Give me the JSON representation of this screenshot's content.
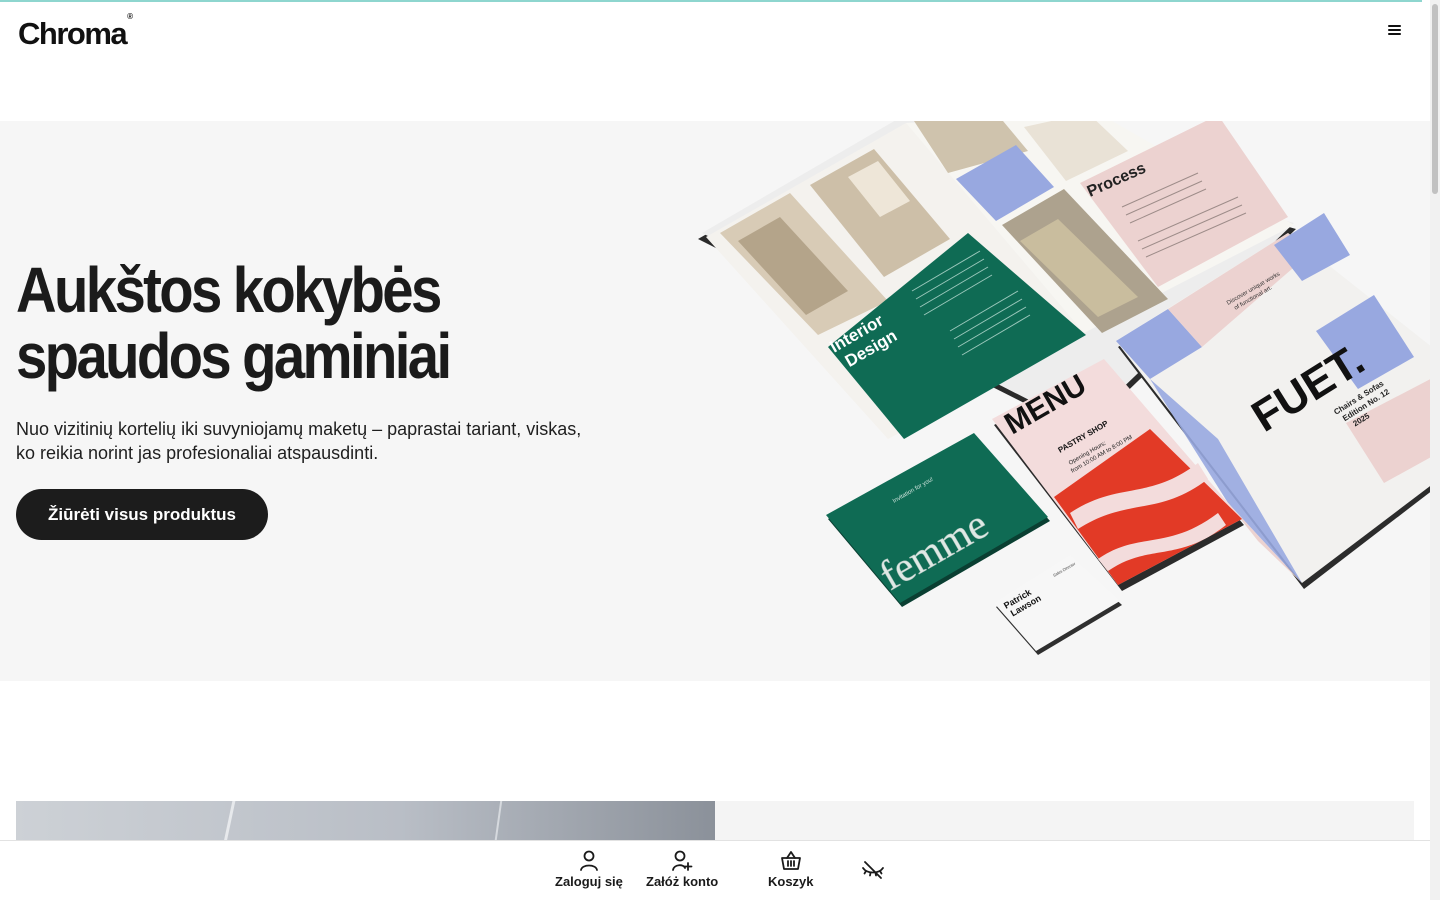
{
  "header": {
    "logo_text": "Chroma",
    "logo_mark": "®",
    "menu_icon": "hamburger-menu-icon"
  },
  "hero": {
    "title_line1": "Aukštos kokybės",
    "title_line2": "spaudos gaminiai",
    "subtitle": "Nuo vizitinių kortelių iki suvyniojamų maketų – paprastai tariant, viskas, ko reikia norint jas profesionaliai atspausdinti.",
    "cta_label": "Žiūrėti visus produktus",
    "mockups": {
      "magazine_left_title_line1": "Interior",
      "magazine_left_title_line2": "Design",
      "magazine_right_title": "Process",
      "card_femme_text": "femme",
      "card_femme_tag": "Invitation for you!",
      "menu_title": "MENU",
      "menu_sub": "PASTRY SHOP",
      "menu_hours_line1": "Opening Hours:",
      "menu_hours_line2": "from 10:00 AM to 8:00 PM",
      "fuet_title": "FUET.",
      "fuet_sub_line1": "Chairs & Sofas",
      "fuet_sub_line2": "Edition No. 12",
      "fuet_sub_line3": "2025",
      "fuet_tagline_line1": "Discover unique works",
      "fuet_tagline_line2": "of functional art.",
      "bizcard_name_line1": "Patrick",
      "bizcard_name_line2": "Lawson",
      "bizcard_role": "Sales Director"
    }
  },
  "bottom_bar": {
    "login_label": "Zaloguj się",
    "login_icon": "user-icon",
    "register_label": "Załóż konto",
    "register_icon": "user-plus-icon",
    "cart_label": "Koszyk",
    "cart_icon": "basket-icon",
    "accessibility_icon": "eye-off-icon"
  },
  "colors": {
    "accent_line": "#8ed6cf",
    "hero_bg": "#f6f6f6",
    "cta_bg": "#1c1c1c",
    "green": "#0f6b54",
    "red": "#e23a26",
    "blue": "#98a8e0",
    "pink": "#ecd2d0"
  }
}
